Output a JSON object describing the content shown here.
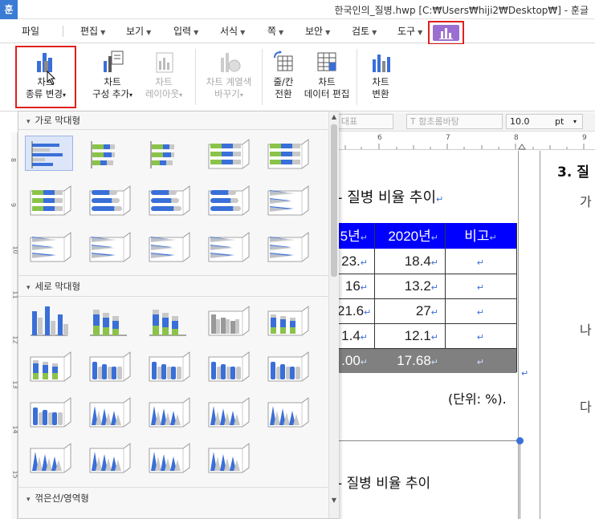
{
  "titlebar": {
    "app_glyph": "훈",
    "title": "한국인의_질병.hwp [C:₩Users₩hiji2₩Desktop₩] - 훈글"
  },
  "menu": [
    {
      "label": "파일",
      "arrow": false
    },
    {
      "label": "편집",
      "arrow": true
    },
    {
      "label": "보기",
      "arrow": true
    },
    {
      "label": "입력",
      "arrow": true
    },
    {
      "label": "서식",
      "arrow": true
    },
    {
      "label": "쪽",
      "arrow": true
    },
    {
      "label": "보안",
      "arrow": true
    },
    {
      "label": "검토",
      "arrow": true
    },
    {
      "label": "도구",
      "arrow": true
    }
  ],
  "ribbon": {
    "change_type": {
      "line1": "차트",
      "line2": "종류 변경",
      "icon": "bar-chart-icon"
    },
    "add_component": {
      "line1": "차트",
      "line2": "구성 추가",
      "icon": "chart-component-icon"
    },
    "layout": {
      "line1": "차트",
      "line2": "레이아웃",
      "icon": "chart-layout-icon"
    },
    "series_color": {
      "line1": "차트 계열색",
      "line2": "바꾸기",
      "icon": "palette-icon"
    },
    "row_col": {
      "line1": "줄/칸",
      "line2": "전환",
      "icon": "swap-icon"
    },
    "data_edit": {
      "line1": "차트",
      "line2": "데이터 편집",
      "icon": "table-edit-icon"
    },
    "convert": {
      "line1": "차트",
      "line2": "변환",
      "icon": "chart-convert-icon"
    }
  },
  "formatbar": {
    "style": "대표",
    "font": "함초롬바탕",
    "size": "10.0",
    "unit": "pt"
  },
  "ruler": {
    "marks": [
      "6",
      "7",
      "8",
      "9"
    ]
  },
  "vruler": {
    "marks": [
      "8",
      "9",
      "10",
      "11",
      "12",
      "13",
      "14",
      "15"
    ]
  },
  "gallery": {
    "sections": [
      {
        "label": "가로 막대형"
      },
      {
        "label": "세로 막대형"
      },
      {
        "label": "꺾은선/영역형"
      }
    ]
  },
  "doc": {
    "heading": "3. 질",
    "chart_title": "질병 비율 추이",
    "chart_title2": "질병 비율 추이",
    "side_chars": [
      "가",
      "나",
      "다"
    ],
    "table_header": [
      "5년",
      "2020년",
      "비고"
    ],
    "rows": [
      [
        "23.",
        "18.4"
      ],
      [
        "16",
        "13.2"
      ],
      [
        "21.6",
        "27"
      ],
      [
        "1.4",
        "12.1"
      ]
    ],
    "total_row": [
      ".00",
      "17.68"
    ],
    "unit_note": "(단위: %)."
  },
  "colors": {
    "accent_red": "#e02020",
    "chart_tab": "#9b6fd1",
    "header_blue": "#0000ff",
    "total_gray": "#808080"
  }
}
